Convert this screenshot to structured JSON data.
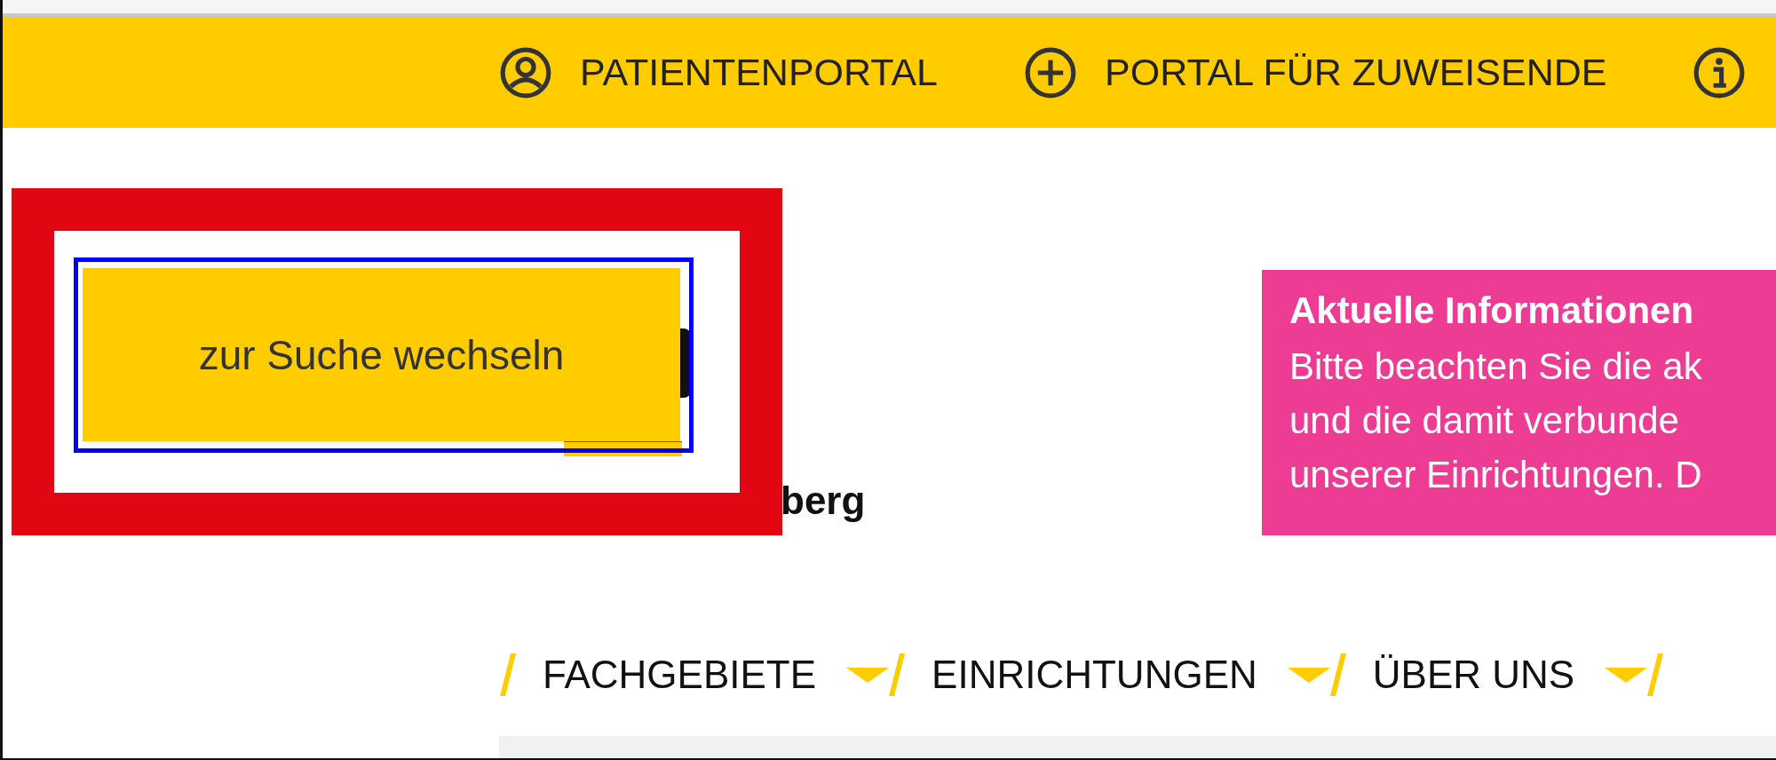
{
  "top_bar": {
    "links": [
      {
        "label": "PATIENTENPORTAL"
      },
      {
        "label": "PORTAL FÜR ZUWEISENDE"
      }
    ]
  },
  "search_toggle": {
    "label": "zur Suche wechseln",
    "focused": true,
    "highlighted": true
  },
  "heading_fragment": "berg",
  "notice": {
    "title": "Aktuelle Informationen",
    "lines": [
      "Bitte beachten Sie die ak",
      "und die damit verbunde",
      "unserer Einrichtungen. D"
    ]
  },
  "nav": [
    {
      "label": "FACHGEBIETE",
      "has_dropdown": true
    },
    {
      "label": "EINRICHTUNGEN",
      "has_dropdown": true
    },
    {
      "label": "ÜBER UNS",
      "has_dropdown": true
    }
  ]
}
